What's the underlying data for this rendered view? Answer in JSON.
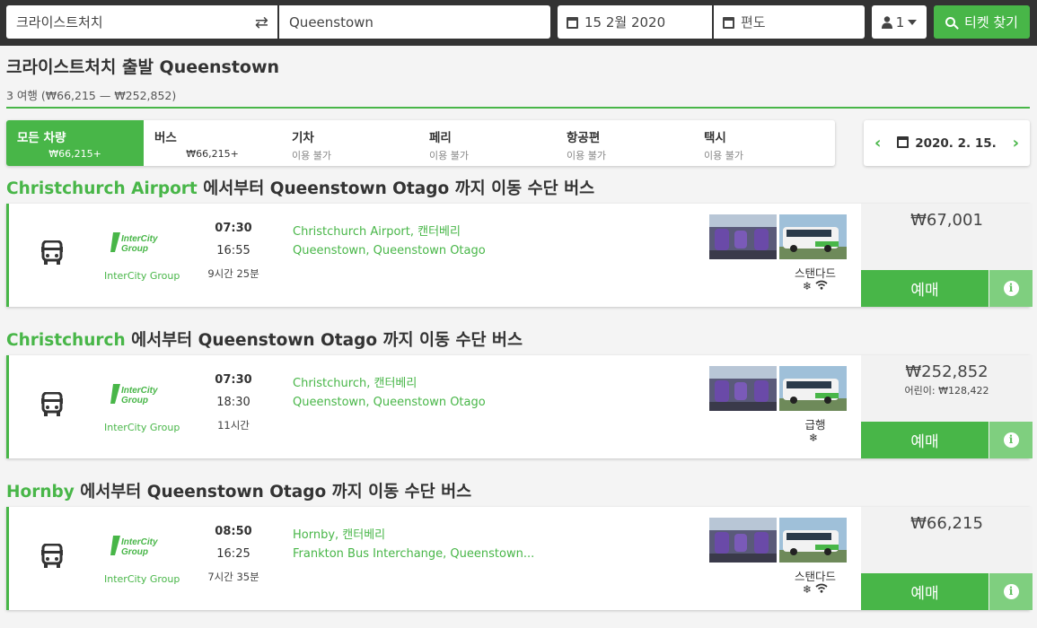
{
  "search": {
    "from_value": "크라이스트처치",
    "to_value": "Queenstown",
    "date_value": "15 2월 2020",
    "return_placeholder": "편도",
    "passengers": "1",
    "search_label": "티켓 찾기",
    "accent_color": "#48b648"
  },
  "header": {
    "title": "크라이스트처치 출발 Queenstown",
    "summary": "3 여행 (₩66,215 — ₩252,852)"
  },
  "tabs": [
    {
      "label": "모든 차량",
      "sub": "₩66,215+"
    },
    {
      "label": "버스",
      "sub": "₩66,215+"
    },
    {
      "label": "기차",
      "sub": "이용 불가"
    },
    {
      "label": "페리",
      "sub": "이용 불가"
    },
    {
      "label": "항공편",
      "sub": "이용 불가"
    },
    {
      "label": "택시",
      "sub": "이용 불가"
    }
  ],
  "date_nav": {
    "date": "2020. 2. 15.",
    "prev_icon": "chevron-left-icon",
    "next_icon": "chevron-right-icon"
  },
  "trips": [
    {
      "city": "Christchurch Airport",
      "title_rest": "에서부터 Queenstown Otago 까지 이동 수단 버스",
      "operator": "InterCity Group",
      "dep_time": "07:30",
      "arr_time": "16:55",
      "duration": "9시간 25분",
      "from_stop": "Christchurch Airport, 캔터베리",
      "to_stop": "Queenstown, Queenstown Otago",
      "class": "스탠다드",
      "amenities": "❄ wifi",
      "price": "₩67,001",
      "child_price": "",
      "book_label": "예매"
    },
    {
      "city": "Christchurch",
      "title_rest": "에서부터 Queenstown Otago 까지 이동 수단 버스",
      "operator": "InterCity Group",
      "dep_time": "07:30",
      "arr_time": "18:30",
      "duration": "11시간",
      "from_stop": "Christchurch, 캔터베리",
      "to_stop": "Queenstown, Queenstown Otago",
      "class": "급행",
      "amenities": "❄",
      "price": "₩252,852",
      "child_price": "어린이: ₩128,422",
      "book_label": "예매"
    },
    {
      "city": "Hornby",
      "title_rest": "에서부터 Queenstown Otago 까지 이동 수단 버스",
      "operator": "InterCity Group",
      "dep_time": "08:50",
      "arr_time": "16:25",
      "duration": "7시간 35분",
      "from_stop": "Hornby, 캔터베리",
      "to_stop": "Frankton Bus Interchange, Queenstown...",
      "class": "스탠다드",
      "amenities": "❄ wifi",
      "price": "₩66,215",
      "child_price": "",
      "book_label": "예매"
    }
  ]
}
